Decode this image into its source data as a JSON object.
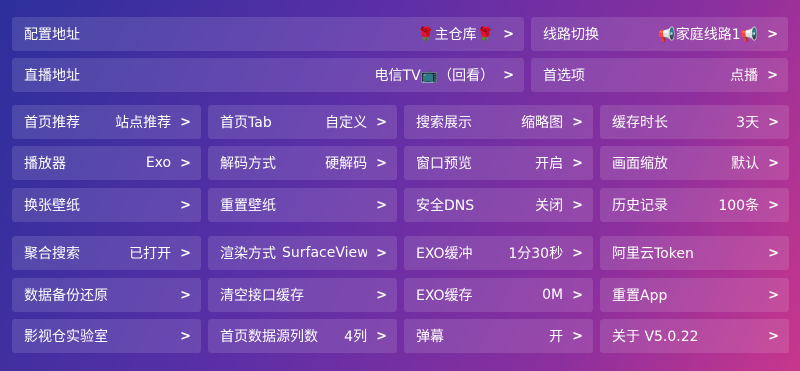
{
  "top_rows": [
    [
      {
        "label": "配置地址",
        "value": "🌹主仓库🌹",
        "arrow": ">"
      },
      {
        "label": "线路切换",
        "value": "📢家庭线路1📢",
        "arrow": ">"
      }
    ],
    [
      {
        "label": "直播地址",
        "value": "电信TV📺（回看）",
        "arrow": ">"
      },
      {
        "label": "首选项",
        "value": "点播",
        "arrow": ">"
      }
    ]
  ],
  "grid_rows": [
    [
      {
        "label": "首页推荐",
        "value": "站点推荐",
        "arrow": ">"
      },
      {
        "label": "首页Tab",
        "value": "自定义",
        "arrow": ">"
      },
      {
        "label": "搜索展示",
        "value": "缩略图",
        "arrow": ">"
      },
      {
        "label": "缓存时长",
        "value": "3天",
        "arrow": ">"
      }
    ],
    [
      {
        "label": "播放器",
        "value": "Exo",
        "arrow": ">"
      },
      {
        "label": "解码方式",
        "value": "硬解码",
        "arrow": ">"
      },
      {
        "label": "窗口预览",
        "value": "开启",
        "arrow": ">"
      },
      {
        "label": "画面缩放",
        "value": "默认",
        "arrow": ">"
      }
    ],
    [
      {
        "label": "换张壁纸",
        "value": "",
        "arrow": ">"
      },
      {
        "label": "重置壁纸",
        "value": "",
        "arrow": ">"
      },
      {
        "label": "安全DNS",
        "value": "关闭",
        "arrow": ">"
      },
      {
        "label": "历史记录",
        "value": "100条",
        "arrow": ">"
      }
    ],
    [
      {
        "label": "聚合搜索",
        "value": "已打开",
        "arrow": ">"
      },
      {
        "label": "渲染方式",
        "value": "SurfaceView",
        "arrow": ">"
      },
      {
        "label": "EXO缓冲",
        "value": "1分30秒",
        "arrow": ">"
      },
      {
        "label": "阿里云Token",
        "value": "",
        "arrow": ">"
      }
    ],
    [
      {
        "label": "数据备份还原",
        "value": "",
        "arrow": ">"
      },
      {
        "label": "清空接口缓存",
        "value": "",
        "arrow": ">"
      },
      {
        "label": "EXO缓存",
        "value": "0M",
        "arrow": ">"
      },
      {
        "label": "重置App",
        "value": "",
        "arrow": ">"
      }
    ],
    [
      {
        "label": "影视仓实验室",
        "value": "",
        "arrow": ">"
      },
      {
        "label": "首页数据源列数",
        "value": "4列",
        "arrow": ">"
      },
      {
        "label": "弹幕",
        "value": "开",
        "arrow": ">"
      },
      {
        "label": "关于  V5.0.22",
        "value": "",
        "arrow": ">"
      }
    ]
  ]
}
